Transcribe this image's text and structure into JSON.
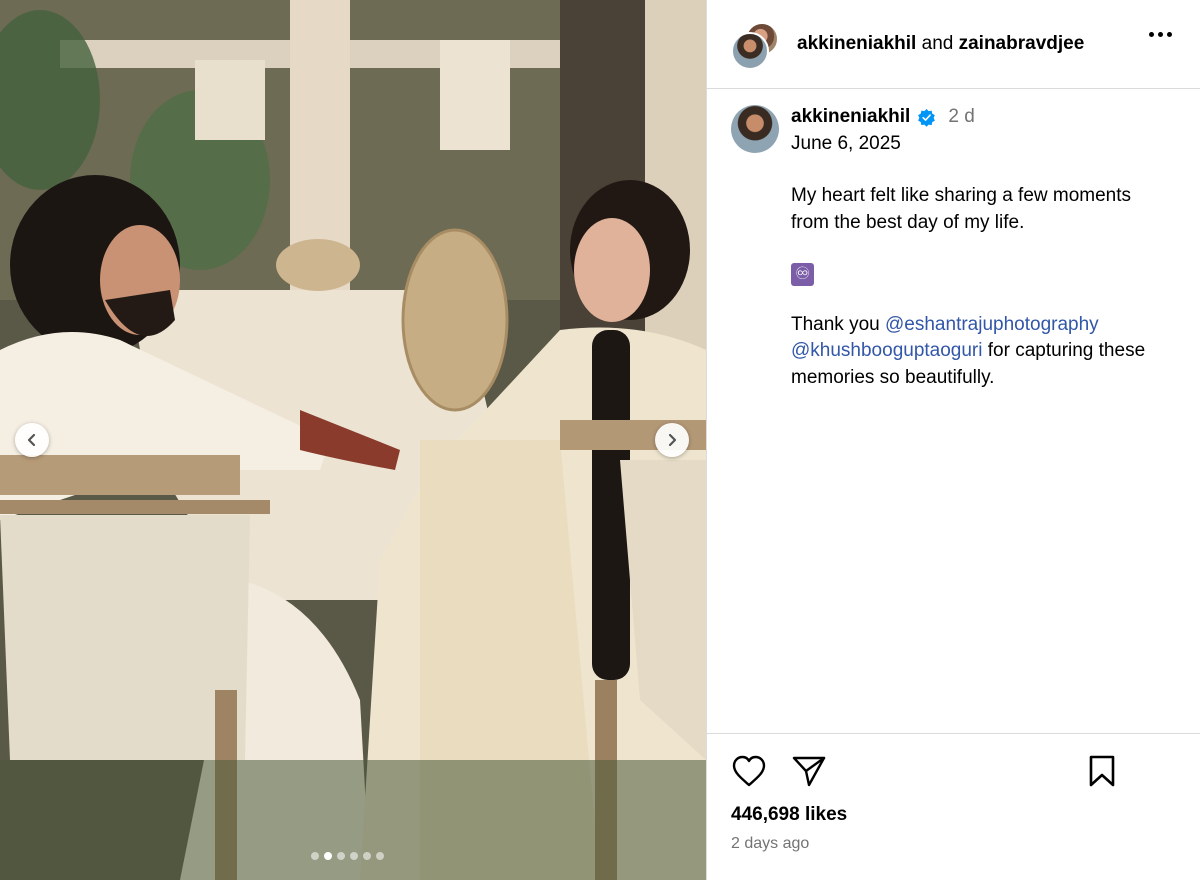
{
  "header": {
    "user1": "akkineniakhil",
    "joiner": "and",
    "user2": "zainabravdjee",
    "more_icon": "more-horizontal-icon"
  },
  "caption": {
    "username": "akkineniakhil",
    "verified_icon": "verified-badge-icon",
    "relative_time": "2 d",
    "date": "June 6, 2025",
    "text": "My heart felt like sharing a few moments from the best day of my life.",
    "emoji": "♾",
    "thanks_prefix": "Thank you",
    "mention1": "@eshantrajuphotography",
    "mention2": "@khushbooguptaoguri",
    "thanks_suffix": "for capturing these memories so beautifully."
  },
  "media": {
    "prev_icon": "chevron-left-icon",
    "next_icon": "chevron-right-icon",
    "carousel_count": 6,
    "carousel_active_index": 1
  },
  "actions": {
    "like_icon": "heart-icon",
    "share_icon": "send-icon",
    "save_icon": "bookmark-icon",
    "likes": "446,698 likes",
    "time": "2 days ago"
  },
  "colors": {
    "mention": "#3257a8",
    "verified": "#0095f6",
    "muted": "#737373",
    "divider": "#dbdbdb"
  }
}
